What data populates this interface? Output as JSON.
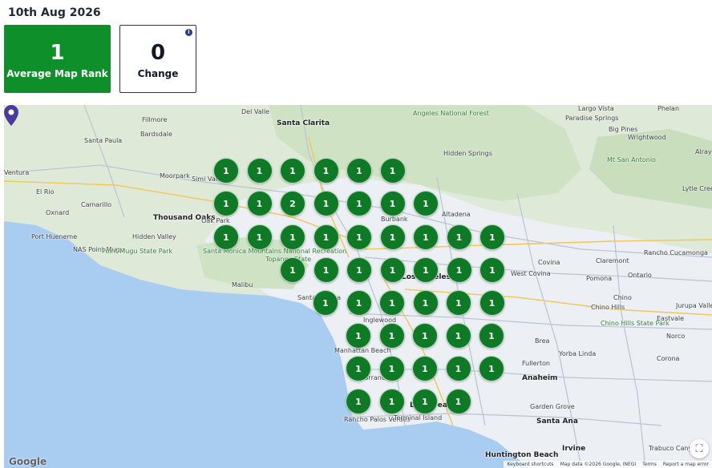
{
  "header": {
    "date": "10th Aug 2026"
  },
  "stats": {
    "average_rank": {
      "value": "1",
      "label": "Average Map Rank",
      "color": "#0e8f2a"
    },
    "change": {
      "value": "0",
      "label": "Change",
      "info_icon": "info-icon"
    }
  },
  "map": {
    "marker_color": "#0f7a25",
    "ranks": [
      [
        "1",
        "1",
        "1",
        "1",
        "1",
        "1"
      ],
      [
        "1",
        "1",
        "2",
        "1",
        "1",
        "1",
        "1"
      ],
      [
        "1",
        "1",
        "1",
        "1",
        "1",
        "1",
        "1",
        "1",
        "1"
      ],
      [
        "1",
        "1",
        "1",
        "1",
        "1",
        "1",
        "1"
      ],
      [
        "1",
        "1",
        "1",
        "1",
        "1",
        "1"
      ],
      [
        "1",
        "1",
        "1",
        "1",
        "1"
      ],
      [
        "1",
        "1",
        "1",
        "1",
        "1"
      ],
      [
        "1",
        "1",
        "1",
        "1"
      ]
    ],
    "labels": [
      {
        "text": "Santa Clarita",
        "class": "city"
      },
      {
        "text": "Fillmore",
        "class": ""
      },
      {
        "text": "Bardsdale",
        "class": ""
      },
      {
        "text": "Santa Paula",
        "class": ""
      },
      {
        "text": "Del Valle",
        "class": ""
      },
      {
        "text": "Angeles National Forest",
        "class": "park"
      },
      {
        "text": "Largo Vista",
        "class": ""
      },
      {
        "text": "Phelan",
        "class": ""
      },
      {
        "text": "Paradise Springs",
        "class": ""
      },
      {
        "text": "Big Pines",
        "class": ""
      },
      {
        "text": "Wrightwood",
        "class": ""
      },
      {
        "text": "Hidden Springs",
        "class": ""
      },
      {
        "text": "Mt San Antonio",
        "class": "park"
      },
      {
        "text": "Alray",
        "class": ""
      },
      {
        "text": "Lytle Creek",
        "class": ""
      },
      {
        "text": "Ventura",
        "class": ""
      },
      {
        "text": "El Rio",
        "class": ""
      },
      {
        "text": "Oxnard",
        "class": ""
      },
      {
        "text": "Camarillo",
        "class": ""
      },
      {
        "text": "Moorpark",
        "class": ""
      },
      {
        "text": "Simi Valley",
        "class": ""
      },
      {
        "text": "Thousand Oaks",
        "class": "city"
      },
      {
        "text": "Oak Park",
        "class": ""
      },
      {
        "text": "Port Hueneme",
        "class": ""
      },
      {
        "text": "Hidden Valley",
        "class": ""
      },
      {
        "text": "NAS Point Mugu",
        "class": ""
      },
      {
        "text": "Point Mugu State Park",
        "class": "park"
      },
      {
        "text": "Santa Monica Mountains National Recreation",
        "class": "park"
      },
      {
        "text": "Topanga State",
        "class": "park"
      },
      {
        "text": "Malibu",
        "class": ""
      },
      {
        "text": "Burbank",
        "class": ""
      },
      {
        "text": "Altadena",
        "class": ""
      },
      {
        "text": "Los Angeles",
        "class": "city"
      },
      {
        "text": "Santa Monica",
        "class": ""
      },
      {
        "text": "Inglewood",
        "class": ""
      },
      {
        "text": "Manhattan Beach",
        "class": ""
      },
      {
        "text": "Torrance",
        "class": ""
      },
      {
        "text": "Rancho Palos Verdes",
        "class": ""
      },
      {
        "text": "Terminal Island",
        "class": ""
      },
      {
        "text": "Long Beach",
        "class": "city"
      },
      {
        "text": "Covina",
        "class": ""
      },
      {
        "text": "West Covina",
        "class": ""
      },
      {
        "text": "Claremont",
        "class": ""
      },
      {
        "text": "Rancho Cucamonga",
        "class": ""
      },
      {
        "text": "Pomona",
        "class": ""
      },
      {
        "text": "Ontario",
        "class": ""
      },
      {
        "text": "Chino",
        "class": ""
      },
      {
        "text": "Chino Hills",
        "class": ""
      },
      {
        "text": "Chino Hills State Park",
        "class": "park"
      },
      {
        "text": "Eastvale",
        "class": ""
      },
      {
        "text": "Jurupa Valley",
        "class": ""
      },
      {
        "text": "Norco",
        "class": ""
      },
      {
        "text": "Brea",
        "class": ""
      },
      {
        "text": "Yorba Linda",
        "class": ""
      },
      {
        "text": "Fullerton",
        "class": ""
      },
      {
        "text": "Corona",
        "class": ""
      },
      {
        "text": "Anaheim",
        "class": "city"
      },
      {
        "text": "Garden Grove",
        "class": ""
      },
      {
        "text": "Santa Ana",
        "class": "city"
      },
      {
        "text": "Irvine",
        "class": "city"
      },
      {
        "text": "Huntington Beach",
        "class": "city"
      },
      {
        "text": "Trabuco Canyon",
        "class": ""
      }
    ],
    "footer": {
      "shortcuts": "Keyboard shortcuts",
      "mapdata": "Map data ©2026 Google, INEGI",
      "terms": "Terms",
      "report": "Report a map error"
    },
    "google": "Google"
  }
}
